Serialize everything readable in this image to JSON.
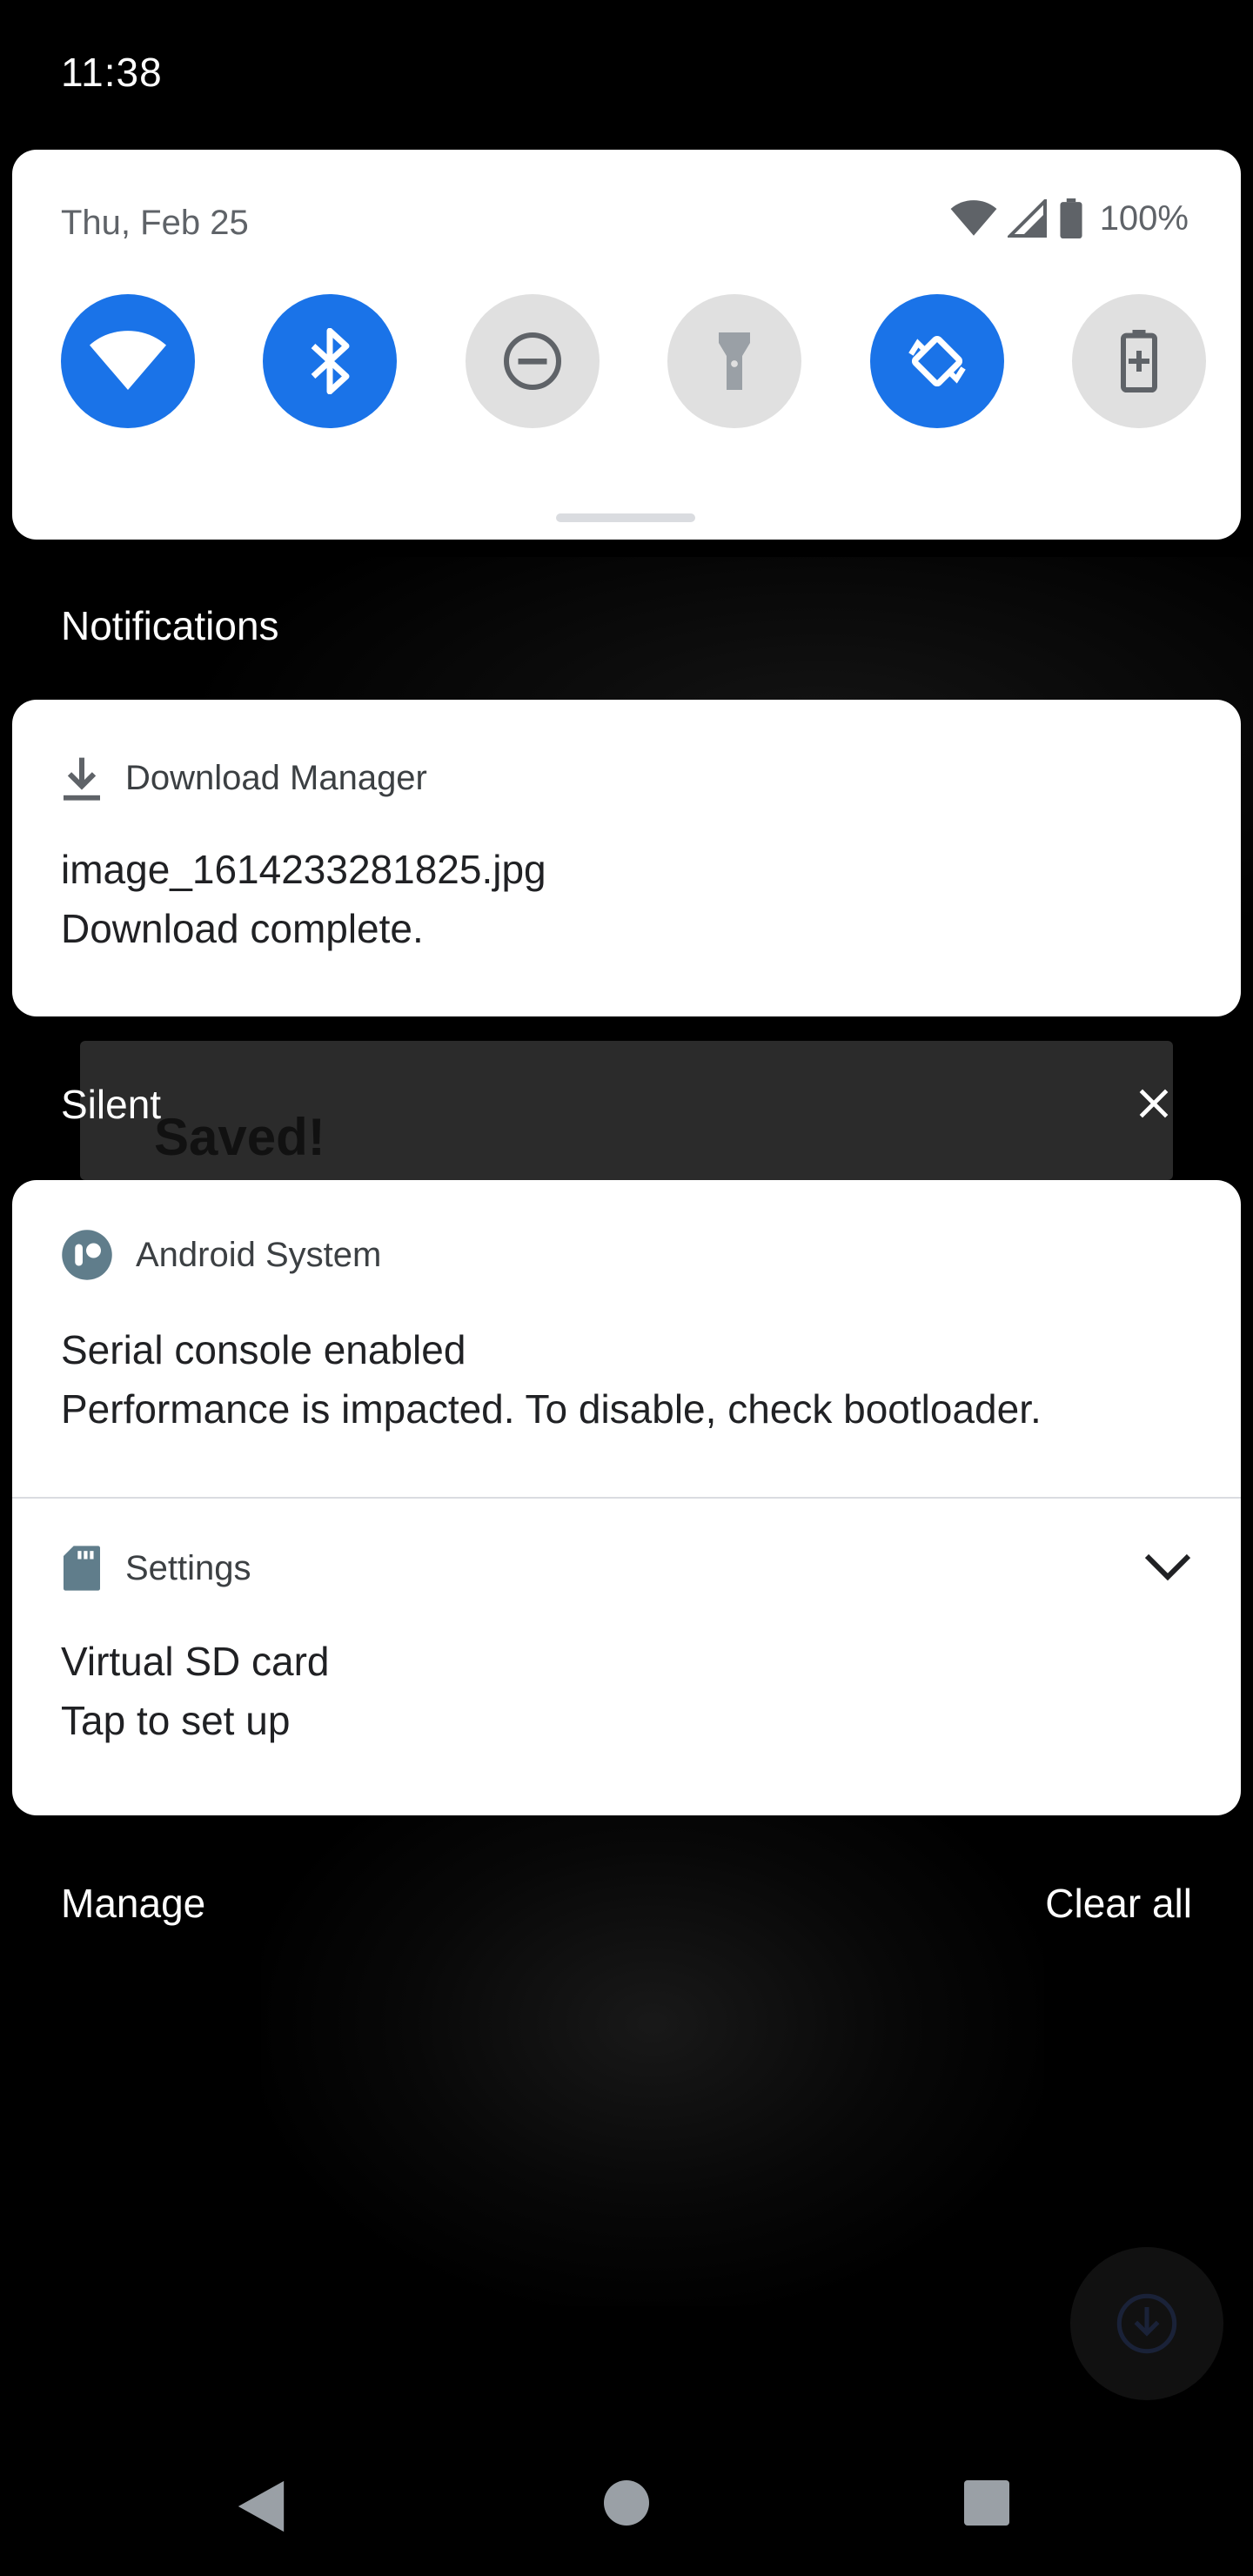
{
  "status_bar": {
    "time": "11:38"
  },
  "quick_settings": {
    "date": "Thu, Feb 25",
    "battery_percent": "100%",
    "tiles": [
      {
        "name": "wifi",
        "icon": "wifi-icon",
        "state": "on"
      },
      {
        "name": "bluetooth",
        "icon": "bluetooth-icon",
        "state": "on"
      },
      {
        "name": "do-not-disturb",
        "icon": "do-not-disturb-icon",
        "state": "off"
      },
      {
        "name": "flashlight",
        "icon": "flashlight-icon",
        "state": "off"
      },
      {
        "name": "auto-rotate",
        "icon": "auto-rotate-icon",
        "state": "on"
      },
      {
        "name": "battery-saver",
        "icon": "battery-saver-icon",
        "state": "off"
      }
    ]
  },
  "sections": {
    "notifications_title": "Notifications",
    "silent_title": "Silent"
  },
  "notifications": {
    "download": {
      "app": "Download Manager",
      "icon": "download-icon",
      "title": "image_1614233281825.jpg",
      "text": "Download complete."
    },
    "android_system": {
      "app": "Android System",
      "icon": "android-system-icon",
      "title": "Serial console enabled",
      "text": "Performance is impacted. To disable, check bootloader."
    },
    "settings": {
      "app": "Settings",
      "icon": "sd-card-icon",
      "title": "Virtual SD card",
      "text": "Tap to set up"
    }
  },
  "footer": {
    "manage_label": "Manage",
    "clear_all_label": "Clear all"
  },
  "background_app": {
    "snackbar_text": "Saved!"
  },
  "colors": {
    "accent": "#1a73e8",
    "tile_off": "#e0e0e0",
    "panel": "#ffffff",
    "scrim": "#000000"
  }
}
